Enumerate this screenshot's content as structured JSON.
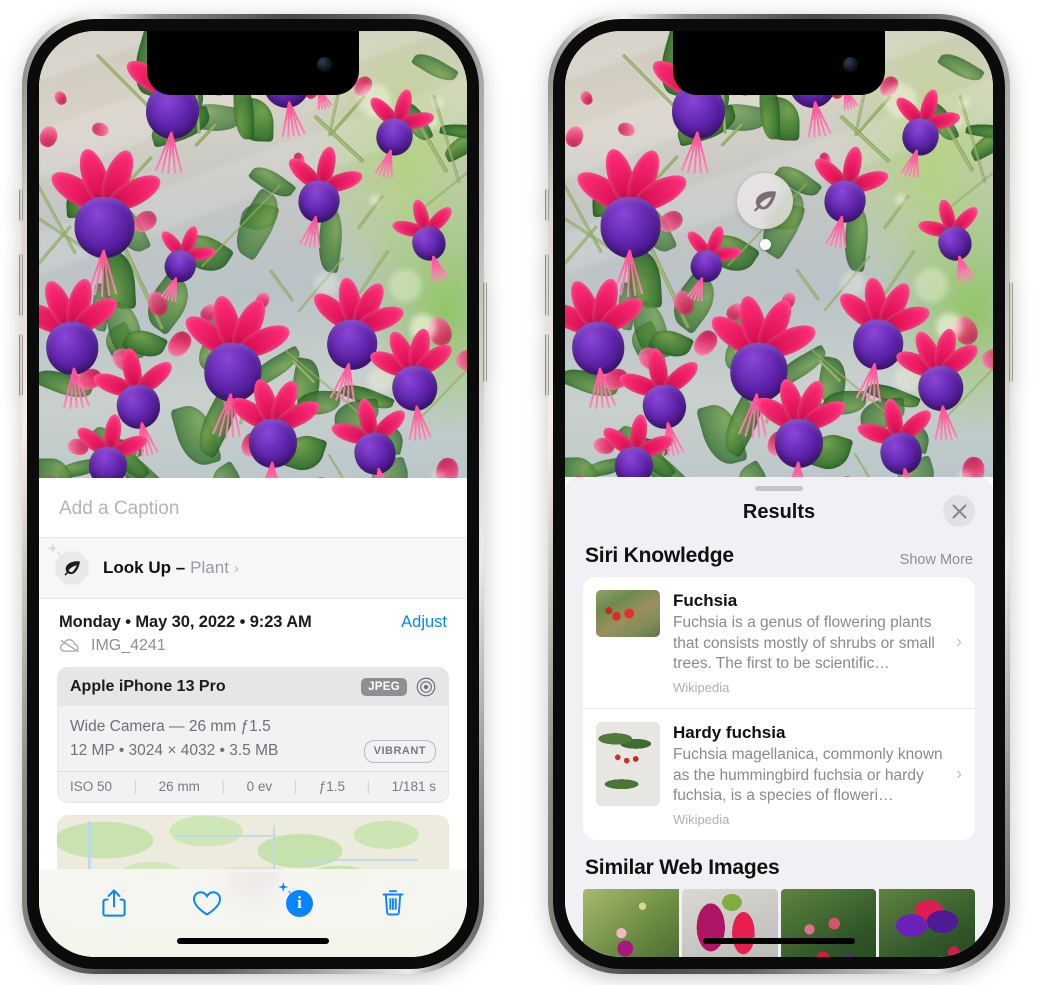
{
  "left_phone": {
    "caption_placeholder": "Add a Caption",
    "lookup": {
      "icon": "leaf-icon",
      "label": "Look Up –",
      "subject": "Plant",
      "chevron": "›"
    },
    "date_line": "Monday • May 30, 2022 • 9:23 AM",
    "adjust_label": "Adjust",
    "file_name": "IMG_4241",
    "cloud_icon": "cloud-slash-icon",
    "metadata": {
      "device": "Apple iPhone 13 Pro",
      "format_badge": "JPEG",
      "lens_icon": "lens-icon",
      "lens_line": "Wide Camera — 26 mm ƒ1.5",
      "size_line": "12 MP • 3024 × 4032 • 3.5 MB",
      "style_badge": "VIBRANT",
      "exif": [
        "ISO 50",
        "26 mm",
        "0 ev",
        "ƒ1.5",
        "1/181 s"
      ]
    },
    "toolbar": [
      {
        "name": "share-button",
        "icon": "share-icon"
      },
      {
        "name": "favorite-button",
        "icon": "heart-icon"
      },
      {
        "name": "info-button",
        "icon": "info-sparkle-icon",
        "glyph": "i",
        "active": true
      },
      {
        "name": "delete-button",
        "icon": "trash-icon"
      }
    ]
  },
  "right_phone": {
    "visual_lookup_badge": {
      "icon": "leaf-icon"
    },
    "sheet": {
      "title": "Results",
      "close_icon": "close-icon",
      "sections": [
        {
          "title": "Siri Knowledge",
          "action": "Show More",
          "items": [
            {
              "title": "Fuchsia",
              "description": "Fuchsia is a genus of flowering plants that consists mostly of shrubs or small trees. The first to be scientific…",
              "source": "Wikipedia",
              "chevron": "›"
            },
            {
              "title": "Hardy fuchsia",
              "description": "Fuchsia magellanica, commonly known as the hummingbird fuchsia or hardy fuchsia, is a species of floweri…",
              "source": "Wikipedia",
              "chevron": "›"
            }
          ]
        },
        {
          "title": "Similar Web Images",
          "thumbnails": [
            {
              "name": "web-image-1"
            },
            {
              "name": "web-image-2"
            },
            {
              "name": "web-image-3"
            },
            {
              "name": "web-image-4"
            }
          ]
        }
      ]
    }
  },
  "colors": {
    "accent_blue": "#0a84ff",
    "sheet_bg": "#f1f1f5",
    "card_bg": "#ffffff",
    "secondary_text": "#8e8e93",
    "badge_gray": "#8e8e93"
  }
}
